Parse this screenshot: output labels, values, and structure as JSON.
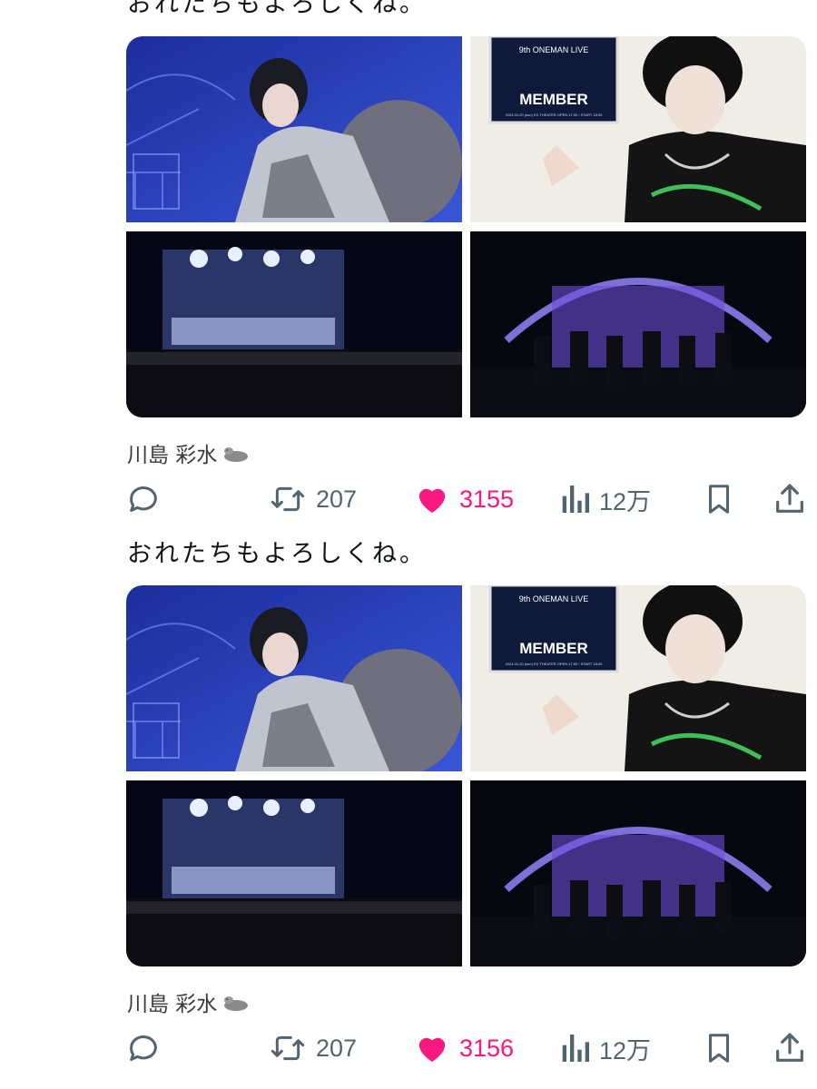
{
  "posts": [
    {
      "text": "おれたちもよろしくね。",
      "author": "川島 彩水",
      "poster": {
        "title": "9th ONEMAN LIVE",
        "band": "MEMBER",
        "footer": "2024.01.20 (sun) EX THEATER OPEN 17:00 / START 18:00"
      },
      "actions": {
        "retweets": "207",
        "likes": "3155",
        "views": "12万"
      }
    },
    {
      "text": "おれたちもよろしくね。",
      "author": "川島 彩水",
      "poster": {
        "title": "9th ONEMAN LIVE",
        "band": "MEMBER",
        "footer": "2024.01.20 (sun) EX THEATER OPEN 17:00 / START 18:00"
      },
      "actions": {
        "retweets": "207",
        "likes": "3156",
        "views": "12万"
      }
    }
  ],
  "icons": {
    "reply": "speech-bubble-icon",
    "retweet": "retweet-arrows-icon",
    "like": "heart-icon",
    "views": "bar-chart-icon",
    "bookmark": "bookmark-icon",
    "share": "share-upload-icon",
    "author_emoji": "seal-emoji-icon"
  },
  "colors": {
    "like": "#f91880",
    "muted": "#536471",
    "text": "#0f1419"
  }
}
